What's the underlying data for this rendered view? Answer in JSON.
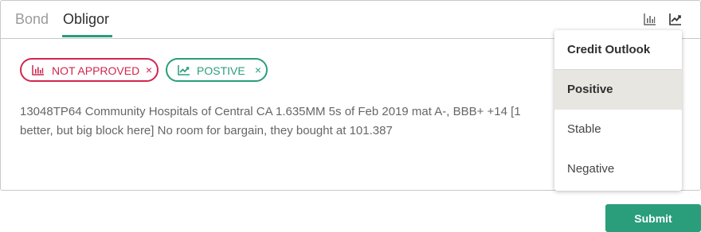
{
  "tabs": {
    "bond": "Bond",
    "obligor": "Obligor"
  },
  "toolbar": {
    "bar_chart_icon": "bar-chart-icon",
    "trend_icon": "trend-icon"
  },
  "chips": {
    "approval": {
      "label": "NOT APPROVED",
      "icon": "bar-chart-icon",
      "color": "#d0264e",
      "close": "×"
    },
    "outlook": {
      "label": "POSTIVE",
      "icon": "trend-icon",
      "color": "#2a9d7b",
      "close": "×"
    }
  },
  "note": {
    "line1": "13048TP64 Community Hospitals of Central CA 1.635MM 5s of Feb 2019 mat A-, BBB+ +14 [1",
    "line2": "better, but big block here] No room for bargain, they bought at 101.387"
  },
  "dropdown": {
    "header": "Credit Outlook",
    "options": [
      "Positive",
      "Stable",
      "Negative"
    ],
    "selected": "Positive"
  },
  "submit_label": "Submit",
  "colors": {
    "accent": "#2a9d7b",
    "danger": "#d0264e",
    "selected_bg": "#e8e6e1"
  }
}
